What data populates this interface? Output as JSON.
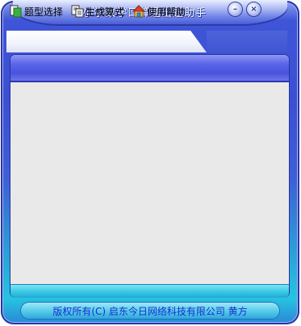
{
  "window": {
    "title": "小学数学口算题出题助手",
    "minimize_symbol": "–",
    "close_symbol": "×"
  },
  "menu": {
    "items": [
      {
        "label": "题型选择",
        "icon": "document-green-icon"
      },
      {
        "label": "生成算式",
        "icon": "copy-documents-icon"
      },
      {
        "label": "使用帮助",
        "icon": "home-icon"
      }
    ]
  },
  "status": {
    "text": "版权所有(C) 启东今日网络科技有限公司 黄方"
  },
  "colors": {
    "frame": "#3b4fd2",
    "panel": "#e9e9e9",
    "status_text": "#1a2bd0"
  }
}
